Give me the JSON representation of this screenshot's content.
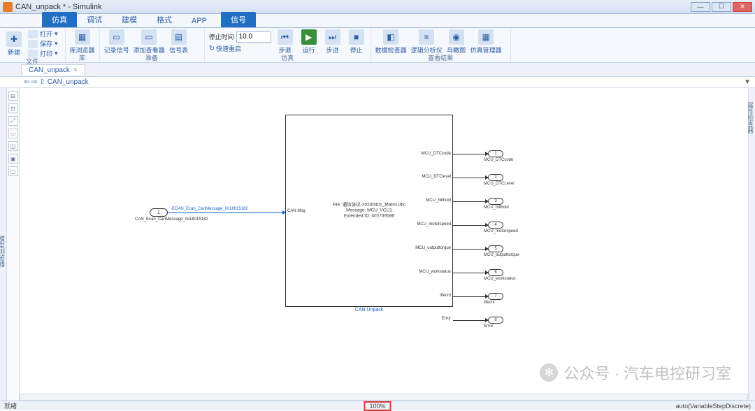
{
  "window": {
    "title": "CAN_unpack * - Simulink",
    "min": "—",
    "max": "☐",
    "close": "✕"
  },
  "tabs": [
    "仿真",
    "调试",
    "建模",
    "格式",
    "APP",
    "信号"
  ],
  "activeTab": 0,
  "ribbon": {
    "new": "新建",
    "open": "打开",
    "save": "保存",
    "print": "打印",
    "file": "文件",
    "libBrowser": "库浏览器",
    "libGroup": "库",
    "logSignal": "记录信号",
    "addViewer": "添加查看器",
    "sigTable": "信号表",
    "prepGroup": "准备",
    "stopTimeLabel": "停止时间",
    "stopTime": "10.0",
    "fastRestart": "快速重启",
    "stepBack": "步退",
    "run": "运行",
    "stepFwd": "步进",
    "stop": "停止",
    "simGroup": "仿真",
    "dataInsp": "数据检查器",
    "logicAnalyzer": "逻辑分析仪",
    "birdseye": "鸟瞰图",
    "simMgr": "仿真管理器",
    "resultsGroup": "查看结果"
  },
  "doc": {
    "tab": "CAN_unpack",
    "close": "×",
    "path": "CAN_unpack"
  },
  "sideLeft": "模型浏览器",
  "sideRight": "属性检查器",
  "input": {
    "num": "1",
    "label": "CAN_Ecan_CanMessage_0x18015182",
    "portText": "-ECAN_Ecan_CanMessage_0x18015182"
  },
  "canBlock": {
    "inLabel": "CAN Msg",
    "line1": "File: 通信协议-20240401_Matrix.dbc",
    "line2": "Message: MCU_VCU1",
    "line3": "Extended ID: 402739586",
    "caption": "CAN Unpack",
    "outputs": [
      "MCU_DTCcode",
      "MCU_DTClevel",
      "MCU_hillhold",
      "MCU_motorspeed",
      "MCU_outputtorque",
      "MCU_workstatus",
      "lifecnt",
      "Error"
    ]
  },
  "outports": [
    {
      "n": "1",
      "label": "MCU_DTCcode"
    },
    {
      "n": "2",
      "label": "MCU_DTCLevel"
    },
    {
      "n": "3",
      "label": "MCU_hillhold"
    },
    {
      "n": "4",
      "label": "MCU_motorspeed"
    },
    {
      "n": "5",
      "label": "MCU_outputtorque"
    },
    {
      "n": "6",
      "label": "MCU_workstatus"
    },
    {
      "n": "7",
      "label": "lifecnt"
    },
    {
      "n": "8",
      "label": "Error"
    }
  ],
  "watermark": {
    "brand": "公众号 · 汽车电控研习室"
  },
  "status": {
    "ready": "就绪",
    "zoom": "100%",
    "solver": "auto(VariableStepDiscrete)"
  }
}
